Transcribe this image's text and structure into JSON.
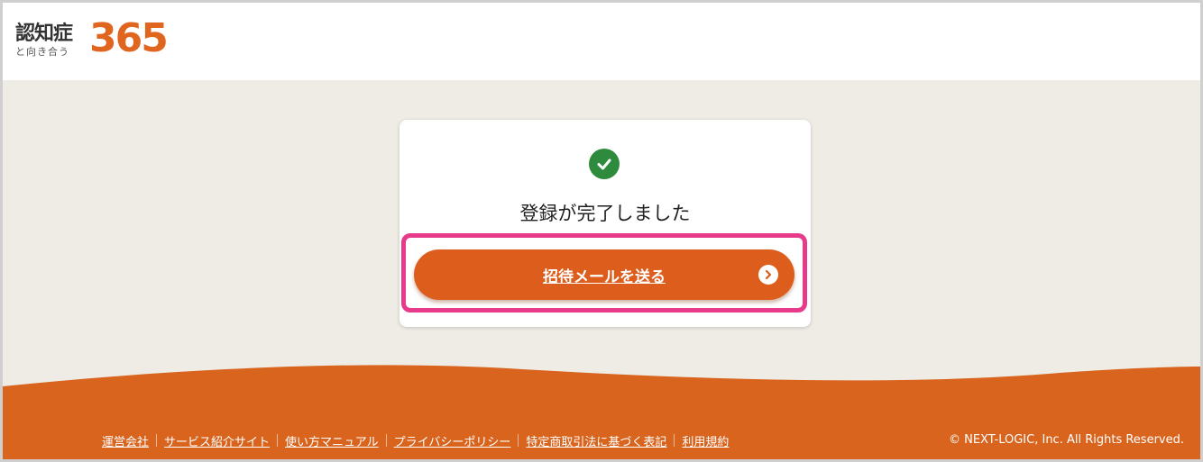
{
  "header": {
    "logo_main": "認知症",
    "logo_sub": "と向き合う",
    "logo_num": "365"
  },
  "card": {
    "icon": "check-circle-icon",
    "title": "登録が完了しました",
    "invite_button_label": "招待メールを送る",
    "invite_button_icon": "chevron-right-icon"
  },
  "footer": {
    "links": [
      "運営会社",
      "サービス紹介サイト",
      "使い方マニュアル",
      "プライバシーポリシー",
      "特定商取引法に基づく表記",
      "利用規約"
    ],
    "copyright": "© NEXT-LOGIC, Inc. All Rights Reserved."
  },
  "colors": {
    "accent": "#dc5d1c",
    "success": "#2e8a3c",
    "highlight": "#e83a8a",
    "background": "#efebe5"
  }
}
